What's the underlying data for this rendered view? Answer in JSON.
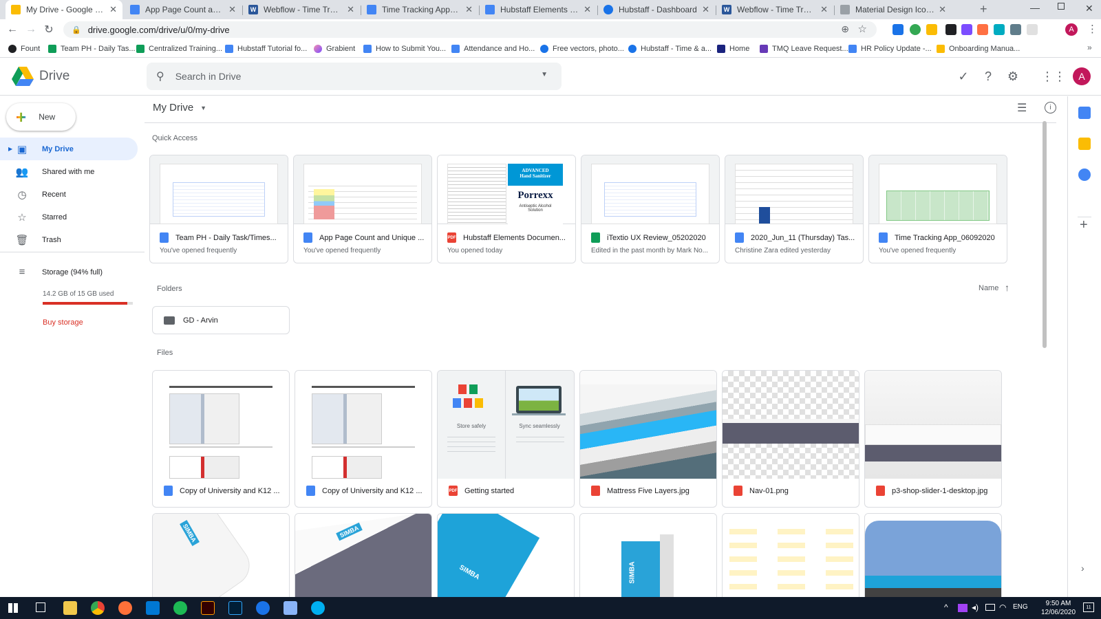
{
  "browser": {
    "tabs": [
      {
        "title": "My Drive - Google Drive",
        "icon": "drive-icon",
        "color": "#fbbc04",
        "active": true
      },
      {
        "title": "App Page Count and Uniqu",
        "icon": "docs-icon",
        "color": "#4285f4"
      },
      {
        "title": "Webflow - Time Tracker We",
        "icon": "word-icon",
        "color": "#2b579a"
      },
      {
        "title": "Time Tracking App_060920",
        "icon": "docs-icon",
        "color": "#4285f4"
      },
      {
        "title": "Hubstaff Elements Docume",
        "icon": "docs-icon",
        "color": "#4285f4"
      },
      {
        "title": "Hubstaff - Dashboard",
        "icon": "hubstaff-icon",
        "color": "#1a73e8"
      },
      {
        "title": "Webflow - Time Tracker We",
        "icon": "word-icon",
        "color": "#2b579a"
      },
      {
        "title": "Material Design Iconic Font",
        "icon": "material-icon",
        "color": "#9aa0a6"
      }
    ],
    "new_tab": "+",
    "url": "drive.google.com/drive/u/0/my-drive",
    "bookmarks": [
      {
        "label": "Fount",
        "color": "#202124"
      },
      {
        "label": "Team PH - Daily Tas...",
        "color": "#0f9d58"
      },
      {
        "label": "Centralized Training...",
        "color": "#0f9d58"
      },
      {
        "label": "Hubstaff Tutorial fo...",
        "color": "#4285f4"
      },
      {
        "label": "Grabient",
        "color": "#a142f4"
      },
      {
        "label": "How to Submit You...",
        "color": "#4285f4"
      },
      {
        "label": "Attendance and Ho...",
        "color": "#4285f4"
      },
      {
        "label": "Free vectors, photo...",
        "color": "#1a73e8"
      },
      {
        "label": "Hubstaff - Time & a...",
        "color": "#1a73e8"
      },
      {
        "label": "Home",
        "color": "#1a237e"
      },
      {
        "label": "TMQ Leave Request...",
        "color": "#673ab7"
      },
      {
        "label": "HR Policy Update -...",
        "color": "#4285f4"
      },
      {
        "label": "Onboarding Manua...",
        "color": "#fbbc04"
      }
    ],
    "profile_initial": "A"
  },
  "drive": {
    "logo_text": "Drive",
    "search_placeholder": "Search in Drive",
    "profile_initial": "A",
    "new_label": "New",
    "nav": [
      {
        "label": "My Drive",
        "icon": "my-drive-icon",
        "selected": true
      },
      {
        "label": "Shared with me",
        "icon": "shared-icon"
      },
      {
        "label": "Recent",
        "icon": "clock-icon"
      },
      {
        "label": "Starred",
        "icon": "star-icon"
      },
      {
        "label": "Trash",
        "icon": "trash-icon"
      }
    ],
    "storage": {
      "label": "Storage (94% full)",
      "used_text": "14.2 GB of 15 GB used",
      "fraction": 0.94,
      "buy_label": "Buy storage"
    },
    "title": "My Drive",
    "quick_access_title": "Quick Access",
    "quick_access": [
      {
        "name": "Team PH - Daily Task/Times...",
        "type": "doc",
        "sub": "You've opened frequently"
      },
      {
        "name": "App Page Count and Unique ...",
        "type": "doc",
        "sub": "You've opened frequently"
      },
      {
        "name": "Hubstaff Elements Documen...",
        "type": "pdf",
        "sub": "You opened today"
      },
      {
        "name": "iTextio UX Review_05202020",
        "type": "sheet",
        "sub": "Edited in the past month by Mark No..."
      },
      {
        "name": "2020_Jun_11 (Thursday) Tas...",
        "type": "doc",
        "sub": "Christine Zara edited yesterday"
      },
      {
        "name": "Time Tracking App_06092020",
        "type": "doc",
        "sub": "You've opened frequently"
      }
    ],
    "folders_title": "Folders",
    "sort_label": "Name",
    "folders": [
      {
        "name": "GD - Arvin"
      }
    ],
    "files_title": "Files",
    "files": [
      {
        "name": "Copy of University and K12 ...",
        "type": "doc"
      },
      {
        "name": "Copy of University and K12 ...",
        "type": "doc"
      },
      {
        "name": "Getting started",
        "type": "pdf"
      },
      {
        "name": "Mattress Five Layers.jpg",
        "type": "img"
      },
      {
        "name": "Nav-01.png",
        "type": "img"
      },
      {
        "name": "p3-shop-slider-1-desktop.jpg",
        "type": "img"
      }
    ],
    "getting_started": {
      "left": "Store safely",
      "right": "Sync seamlessly"
    },
    "thumb_text": {
      "advanced": "ADVANCED",
      "hand_sanitizer": "Hand Sanitizer",
      "brand": "Porrexx",
      "antiseptic": "Antiseptic Alcohol Solution",
      "simba": "SIMBA"
    }
  },
  "taskbar": {
    "lang": "ENG",
    "time": "9:50 AM",
    "date": "12/06/2020",
    "notif_count": "11"
  }
}
